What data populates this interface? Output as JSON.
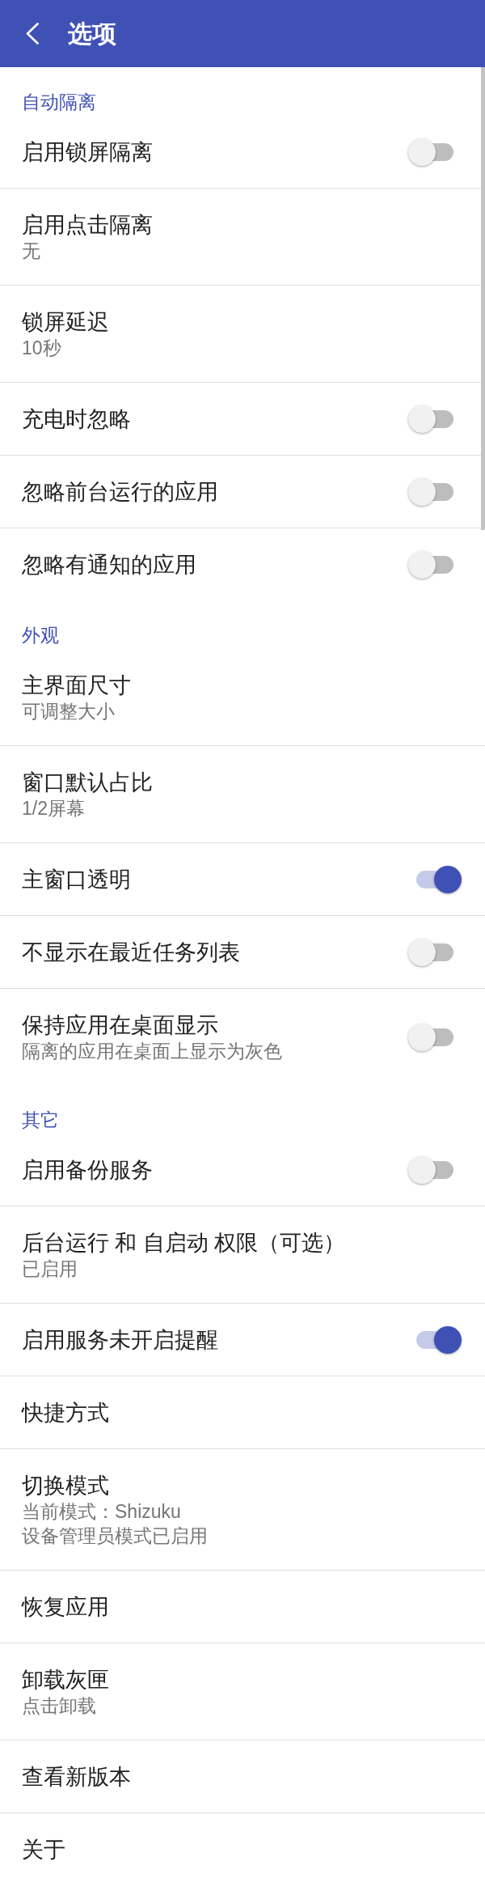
{
  "app_bar": {
    "title": "选项"
  },
  "sections": [
    {
      "title": "自动隔离",
      "items": [
        {
          "kind": "switch",
          "title": "启用锁屏隔离",
          "on": false
        },
        {
          "kind": "text",
          "title": "启用点击隔离",
          "summary": [
            "无"
          ]
        },
        {
          "kind": "text",
          "title": "锁屏延迟",
          "summary": [
            "10秒"
          ]
        },
        {
          "kind": "switch",
          "title": "充电时忽略",
          "on": false
        },
        {
          "kind": "switch",
          "title": "忽略前台运行的应用",
          "on": false
        },
        {
          "kind": "switch",
          "title": "忽略有通知的应用",
          "on": false
        }
      ]
    },
    {
      "title": "外观",
      "items": [
        {
          "kind": "text",
          "title": "主界面尺寸",
          "summary": [
            "可调整大小"
          ]
        },
        {
          "kind": "text",
          "title": "窗口默认占比",
          "summary": [
            "1/2屏幕"
          ]
        },
        {
          "kind": "switch",
          "title": "主窗口透明",
          "on": true
        },
        {
          "kind": "switch",
          "title": "不显示在最近任务列表",
          "on": false
        },
        {
          "kind": "switch",
          "title": "保持应用在桌面显示",
          "summary": [
            "隔离的应用在桌面上显示为灰色"
          ],
          "on": false
        }
      ]
    },
    {
      "title": "其它",
      "items": [
        {
          "kind": "switch",
          "title": "启用备份服务",
          "on": false
        },
        {
          "kind": "text",
          "title": "后台运行 和 自启动 权限（可选）",
          "summary": [
            "已启用"
          ]
        },
        {
          "kind": "switch",
          "title": "启用服务未开启提醒",
          "on": true
        },
        {
          "kind": "text",
          "title": "快捷方式"
        },
        {
          "kind": "text",
          "title": "切换模式",
          "summary": [
            "当前模式：Shizuku",
            "设备管理员模式已启用"
          ]
        },
        {
          "kind": "text",
          "title": "恢复应用"
        },
        {
          "kind": "text",
          "title": "卸载灰匣",
          "summary": [
            "点击卸载"
          ]
        },
        {
          "kind": "text",
          "title": "查看新版本"
        },
        {
          "kind": "text",
          "title": "关于"
        }
      ]
    }
  ]
}
